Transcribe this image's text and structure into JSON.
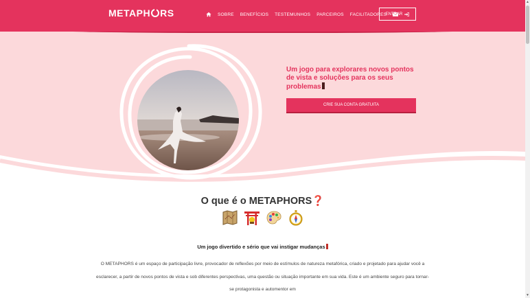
{
  "brand": {
    "name_part1": "METAPH",
    "name_part2": "RS",
    "primary_color": "#e4335d",
    "hero_bg": "#fcd9db"
  },
  "nav": {
    "home_icon": "home-icon",
    "items": [
      "SOBRE",
      "BENEFÍCIOS",
      "TESTEMUNHOS",
      "PARCEIROS",
      "FACILITADORES"
    ],
    "mail_icon": "envelope-icon",
    "login_label": "ENTRAR"
  },
  "hero": {
    "title": "Um jogo para explorares novos pontos de vista e soluções para os seus problemas",
    "cta_label": "CRIE SUA CONTA GRATUITA"
  },
  "about": {
    "title": "O que é o METAPHORS",
    "title_emoji": "❓",
    "emoji_icons": [
      "map-icon",
      "torii-gate-icon",
      "palette-icon",
      "compass-icon"
    ],
    "subtitle": "Um jogo divertido e sério que vai instigar mudanças",
    "paragraph": "O METAPHORS é um espaço de participação livre, provocador de reflexões por meio de estímulos de natureza metafórica, criado e projetado para ajudar você a esclarecer, a partir de novos pontos de vista e sob diferentes perspectivas, uma questão ou situação importante em sua vida. Este é um ambiente seguro para tornar-se protagonista e automentor em"
  }
}
